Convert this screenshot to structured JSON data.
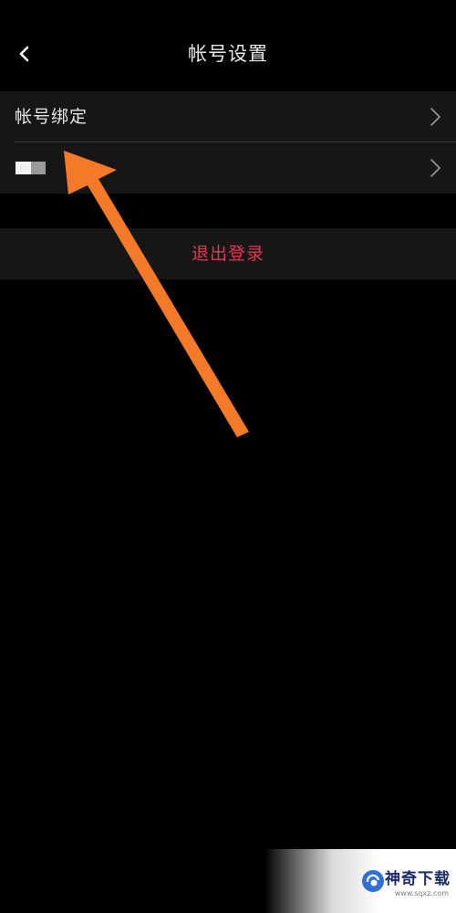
{
  "header": {
    "back_icon": "chevron-left-icon",
    "title": "帐号设置"
  },
  "settings": {
    "items": [
      {
        "label": "帐号绑定",
        "icon": "chevron-right-icon"
      },
      {
        "label": "",
        "masked": true,
        "icon": "chevron-right-icon"
      }
    ]
  },
  "logout": {
    "label": "退出登录",
    "color": "#e0384f"
  },
  "overlay": {
    "arrow_color": "#f47a2a"
  },
  "watermark": {
    "name": "神奇下载",
    "url": "www.sqxz.com"
  },
  "colors": {
    "background": "#000000",
    "row_background": "#161616",
    "divider": "#3a3a3a"
  }
}
